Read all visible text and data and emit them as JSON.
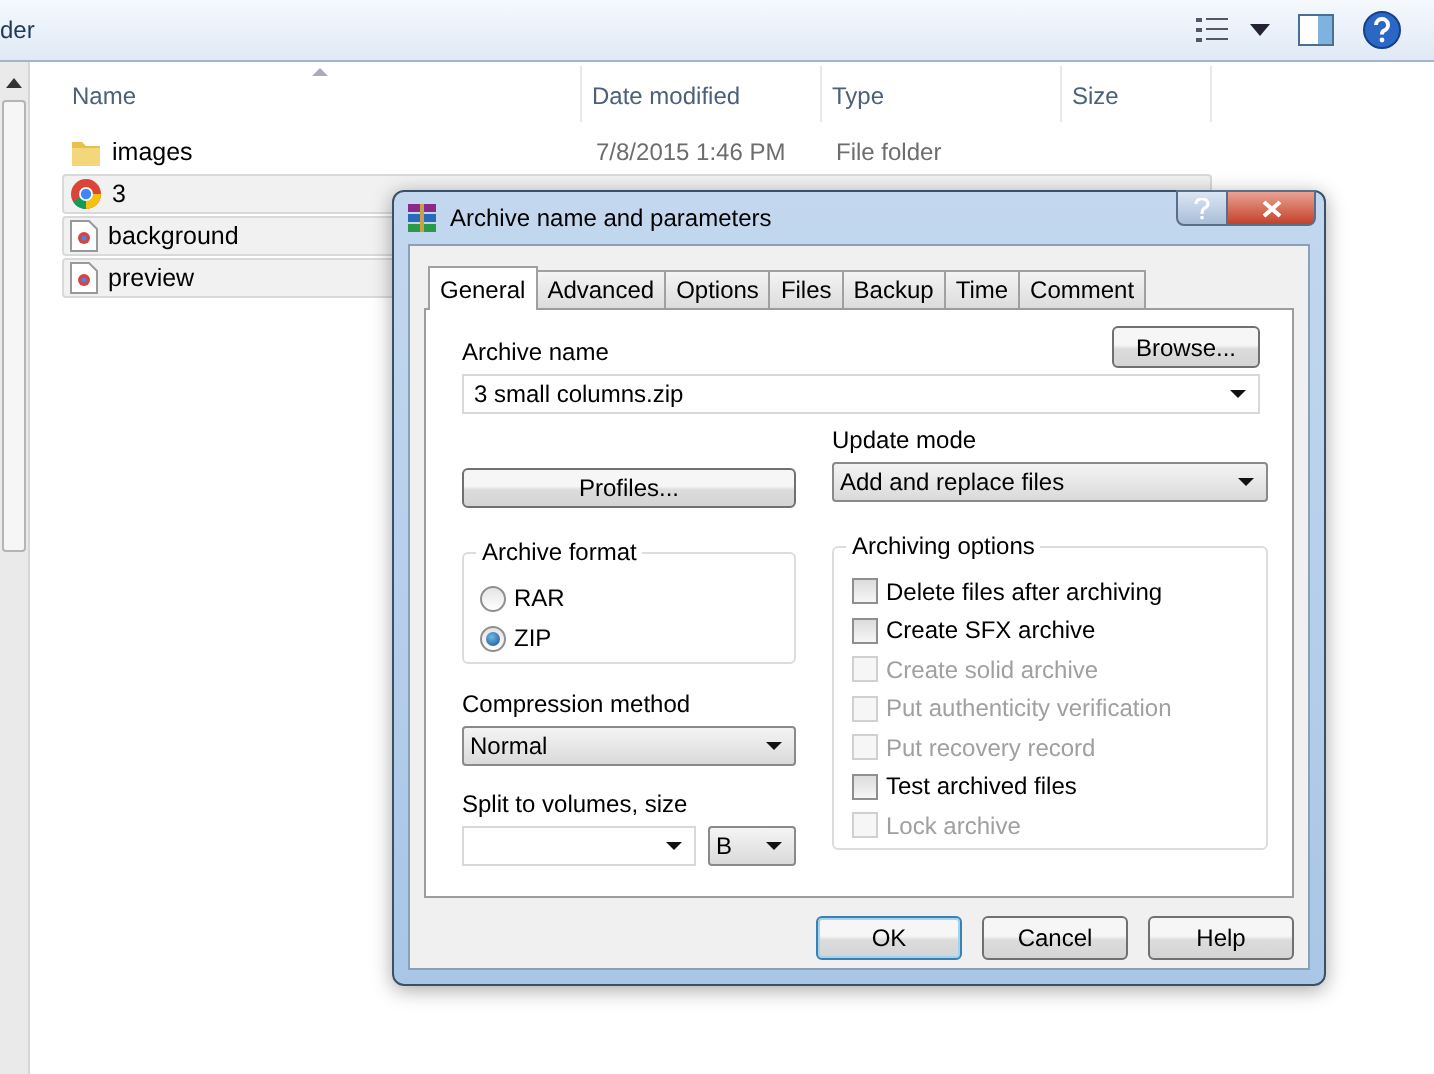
{
  "window": {
    "title": "der"
  },
  "columns": [
    {
      "label": "Name"
    },
    {
      "label": "Date modified"
    },
    {
      "label": "Type"
    },
    {
      "label": "Size"
    }
  ],
  "files": [
    {
      "name": "images",
      "kind": "folder",
      "date": "7/8/2015 1:46 PM",
      "type": "File folder",
      "selected": false
    },
    {
      "name": "3",
      "kind": "chrome",
      "selected": true
    },
    {
      "name": "background",
      "kind": "html",
      "selected": true
    },
    {
      "name": "preview",
      "kind": "html",
      "selected": true
    }
  ],
  "dialog": {
    "title": "Archive name and parameters",
    "tabs": [
      {
        "label": "General",
        "selected": true
      },
      {
        "label": "Advanced",
        "selected": false
      },
      {
        "label": "Options",
        "selected": false
      },
      {
        "label": "Files",
        "selected": false
      },
      {
        "label": "Backup",
        "selected": false
      },
      {
        "label": "Time",
        "selected": false
      },
      {
        "label": "Comment",
        "selected": false
      }
    ],
    "archive_name": {
      "label": "Archive name",
      "value": "3 small columns.zip"
    },
    "browse": "Browse...",
    "profiles": "Profiles...",
    "update_mode": {
      "label": "Update mode",
      "value": "Add and replace files"
    },
    "archive_format": {
      "label": "Archive format",
      "options": [
        {
          "label": "RAR",
          "selected": false
        },
        {
          "label": "ZIP",
          "selected": true
        }
      ]
    },
    "compression": {
      "label": "Compression method",
      "value": "Normal"
    },
    "split": {
      "label": "Split to volumes, size",
      "unit": "B"
    },
    "archiving_options": {
      "label": "Archiving options",
      "items": [
        {
          "label": "Delete files after archiving",
          "checked": false,
          "disabled": false
        },
        {
          "label": "Create SFX archive",
          "checked": false,
          "disabled": false
        },
        {
          "label": "Create solid archive",
          "checked": false,
          "disabled": true
        },
        {
          "label": "Put authenticity verification",
          "checked": false,
          "disabled": true
        },
        {
          "label": "Put recovery record",
          "checked": false,
          "disabled": true
        },
        {
          "label": "Test archived files",
          "checked": false,
          "disabled": false
        },
        {
          "label": "Lock archive",
          "checked": false,
          "disabled": true
        }
      ]
    },
    "buttons": [
      {
        "label": "OK",
        "default": true
      },
      {
        "label": "Cancel",
        "default": false
      },
      {
        "label": "Help",
        "default": false
      }
    ]
  }
}
